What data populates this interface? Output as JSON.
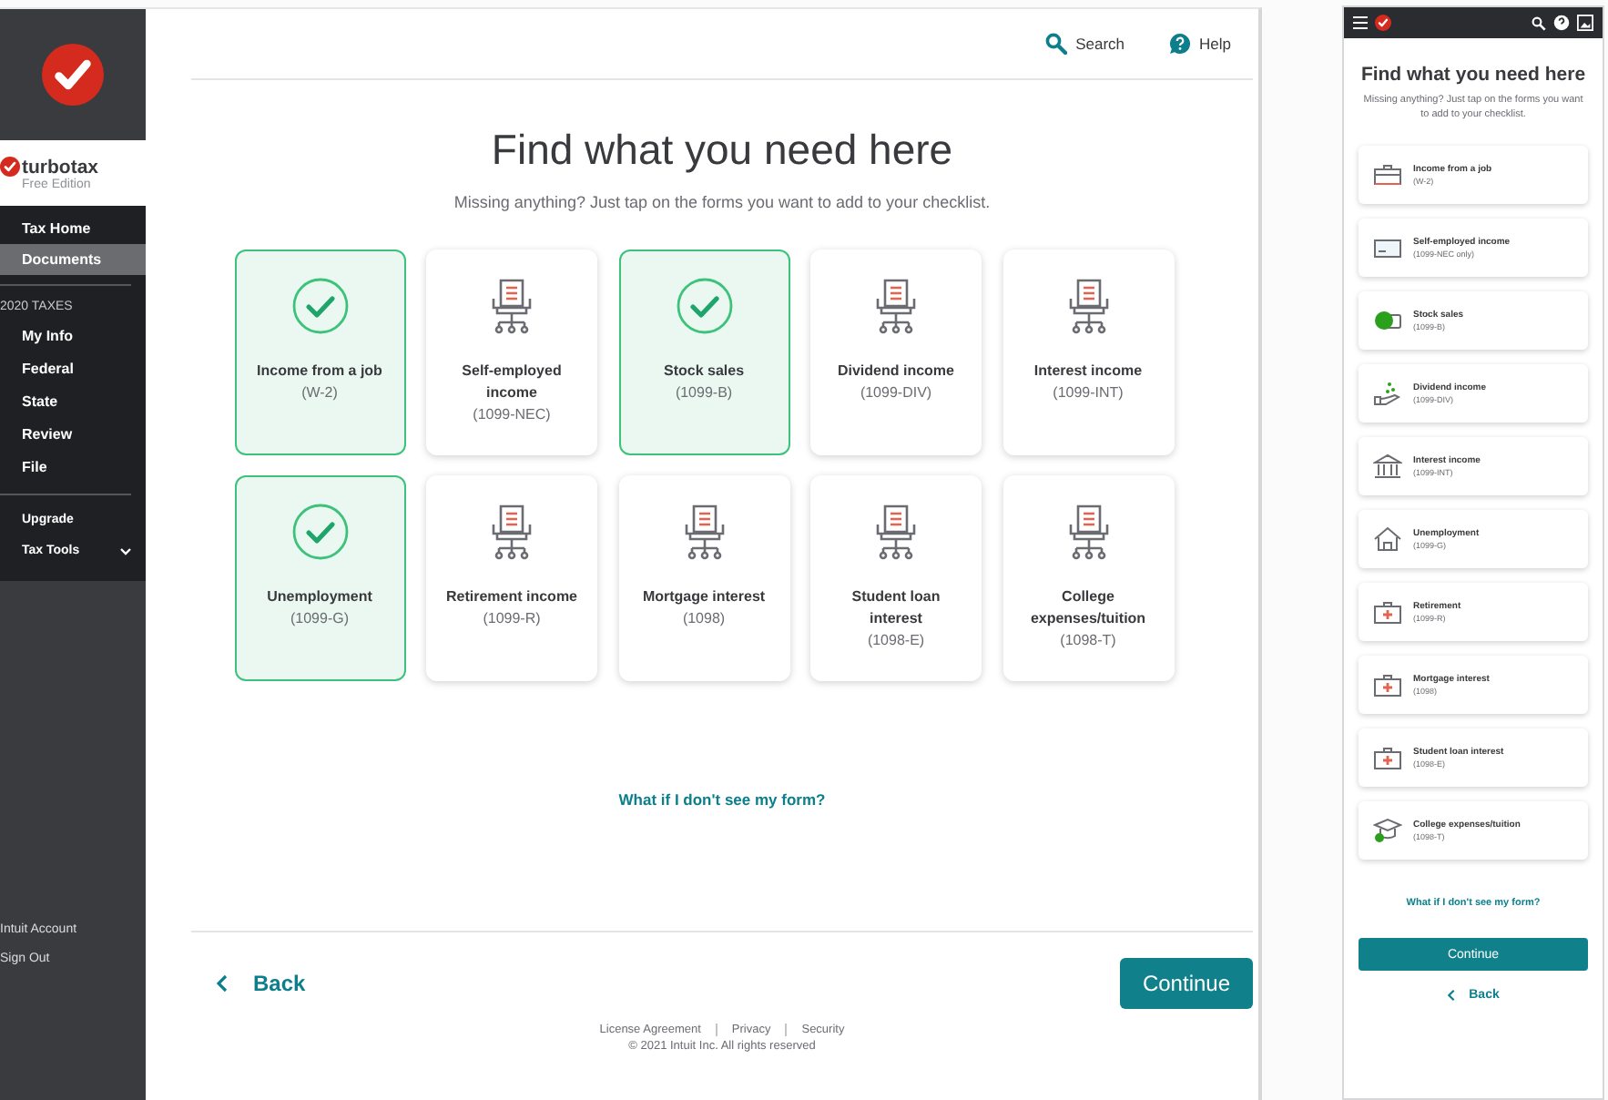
{
  "sidebar": {
    "brand": "turbotax",
    "edition": "Free Edition",
    "nav": [
      {
        "label": "Tax Home",
        "selected": false
      },
      {
        "label": "Documents",
        "selected": true
      }
    ],
    "section_heading": "2020 TAXES",
    "section_items": [
      "My Info",
      "Federal",
      "State",
      "Review",
      "File"
    ],
    "tools": [
      {
        "label": "Upgrade",
        "expandable": false
      },
      {
        "label": "Tax Tools",
        "expandable": true
      }
    ],
    "account_links": [
      "Intuit Account",
      "Sign Out"
    ]
  },
  "header": {
    "links": [
      {
        "label": "Search",
        "kind": "search"
      },
      {
        "label": "Help",
        "kind": "help"
      }
    ]
  },
  "title": "Find what you need here",
  "subtitle": "Missing anything? Just tap on the forms you want to add to your checklist.",
  "forms": [
    {
      "label": "Income from a job",
      "form": "(W-2)",
      "selected": true
    },
    {
      "label": "Self-employed income",
      "form": "(1099-NEC)",
      "selected": false
    },
    {
      "label": "Stock sales",
      "form": "(1099-B)",
      "selected": true
    },
    {
      "label": "Dividend income",
      "form": "(1099-DIV)",
      "selected": false
    },
    {
      "label": "Interest income",
      "form": "(1099-INT)",
      "selected": false
    },
    {
      "label": "Unemployment",
      "form": "(1099-G)",
      "selected": true
    },
    {
      "label": "Retirement income",
      "form": "(1099-R)",
      "selected": false
    },
    {
      "label": "Mortgage interest",
      "form": "(1098)",
      "selected": false
    },
    {
      "label": "Student loan interest",
      "form": "(1098-E)",
      "selected": false
    },
    {
      "label": "College expenses/tuition",
      "form": "(1098-T)",
      "selected": false
    }
  ],
  "help_link": "What if I don't see my form?",
  "back": "Back",
  "continue": "Continue",
  "footer": {
    "links": [
      "License Agreement",
      "Privacy",
      "Security"
    ],
    "copyright": "© 2021 Intuit Inc.  All rights reserved"
  },
  "mobile": {
    "title": "Find what you need here",
    "subtitle": "Missing anything? Just tap on the forms you want to add to your checklist.",
    "forms": [
      {
        "label": "Income from a job",
        "form": "(W-2)",
        "kind": "briefcase"
      },
      {
        "label": "Self-employed income",
        "form": "(1099-NEC only)",
        "kind": "card"
      },
      {
        "label": "Stock sales",
        "form": "(1099-B)",
        "kind": "coin"
      },
      {
        "label": "Dividend income",
        "form": "(1099-DIV)",
        "kind": "hand"
      },
      {
        "label": "Interest income",
        "form": "(1099-INT)",
        "kind": "bank"
      },
      {
        "label": "Unemployment",
        "form": "(1099-G)",
        "kind": "house"
      },
      {
        "label": "Retirement",
        "form": "(1099-R)",
        "kind": "medkit"
      },
      {
        "label": "Mortgage interest",
        "form": "(1098)",
        "kind": "medkit"
      },
      {
        "label": "Student loan interest",
        "form": "(1098-E)",
        "kind": "medkit"
      },
      {
        "label": "College expenses/tuition",
        "form": "(1098-T)",
        "kind": "cap"
      }
    ],
    "help_link": "What if I don't see my form?",
    "continue": "Continue",
    "back": "Back"
  }
}
